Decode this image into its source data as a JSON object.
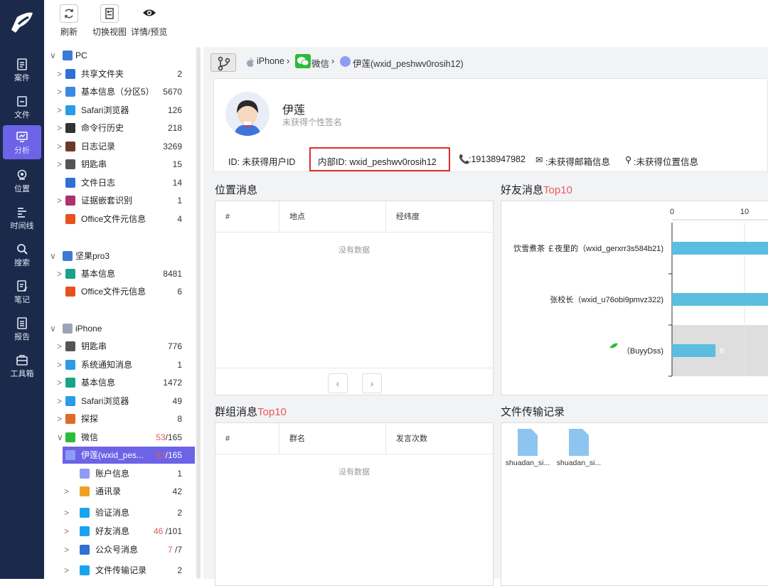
{
  "nav": [
    {
      "label": "案件",
      "icon": "clipboard-icon"
    },
    {
      "label": "文件",
      "icon": "file-icon"
    },
    {
      "label": "分析",
      "icon": "analysis-icon",
      "active": true
    },
    {
      "label": "位置",
      "icon": "location-icon"
    },
    {
      "label": "时间线",
      "icon": "timeline-icon"
    },
    {
      "label": "搜索",
      "icon": "search-icon"
    },
    {
      "label": "笔记",
      "icon": "note-icon"
    },
    {
      "label": "报告",
      "icon": "report-icon"
    },
    {
      "label": "工具箱",
      "icon": "toolbox-icon"
    }
  ],
  "toolbar": {
    "refresh": "刷新",
    "switch_view": "切换视图",
    "detail_preview": "详情/预览"
  },
  "tree": [
    {
      "label": "PC",
      "count": "",
      "level": 0,
      "arrow": "∨"
    },
    {
      "label": "共享文件夹",
      "count": "2",
      "level": 1,
      "arrow": ">"
    },
    {
      "label": "基本信息（分区5）",
      "count": "5670",
      "level": 1,
      "arrow": ">"
    },
    {
      "label": "Safari浏览器",
      "count": "126",
      "level": 1,
      "arrow": ">"
    },
    {
      "label": "命令行历史",
      "count": "218",
      "level": 1,
      "arrow": ">"
    },
    {
      "label": "日志记录",
      "count": "3269",
      "level": 1,
      "arrow": ">"
    },
    {
      "label": "钥匙串",
      "count": "15",
      "level": 1,
      "arrow": ">"
    },
    {
      "label": "文件日志",
      "count": "14",
      "level": 1,
      "arrow": ""
    },
    {
      "label": "证据嵌套识别",
      "count": "1",
      "level": 1,
      "arrow": ">"
    },
    {
      "label": "Office文件元信息",
      "count": "4",
      "level": 1,
      "arrow": ""
    },
    {
      "label": "坚果pro3",
      "count": "",
      "level": 0,
      "arrow": "∨"
    },
    {
      "label": "基本信息",
      "count": "8481",
      "level": 1,
      "arrow": ">"
    },
    {
      "label": "Office文件元信息",
      "count": "6",
      "level": 1,
      "arrow": ""
    },
    {
      "label": "iPhone",
      "count": "",
      "level": 0,
      "arrow": "∨"
    },
    {
      "label": "钥匙串",
      "count": "776",
      "level": 1,
      "arrow": ">"
    },
    {
      "label": "系统通知消息",
      "count": "1",
      "level": 1,
      "arrow": ">"
    },
    {
      "label": "基本信息",
      "count": "1472",
      "level": 1,
      "arrow": ">"
    },
    {
      "label": "Safari浏览器",
      "count": "49",
      "level": 1,
      "arrow": ">"
    },
    {
      "label": "探探",
      "count": "8",
      "level": 1,
      "arrow": ">"
    },
    {
      "label": "微信",
      "count_red": "53",
      "count": "/165",
      "level": 1,
      "arrow": "∨"
    },
    {
      "label": "伊莲(wxid_pes...",
      "count_red": "53",
      "count": "/165",
      "level": 2,
      "arrow": "∨",
      "selected": true
    },
    {
      "label": "账户信息",
      "count": "1",
      "level": 3,
      "arrow": ""
    },
    {
      "label": "通讯录",
      "count": "42",
      "level": 3,
      "arrow": ">"
    },
    {
      "label": "验证消息",
      "count": "2",
      "level": 3,
      "arrow": ">"
    },
    {
      "label": "好友消息",
      "count_red": "46",
      "count": " /101",
      "level": 3,
      "arrow": ">"
    },
    {
      "label": "公众号消息",
      "count_red": "7",
      "count": " /7",
      "level": 3,
      "arrow": ">"
    },
    {
      "label": "文件传输记录",
      "count": "2",
      "level": 3,
      "arrow": ">"
    }
  ],
  "breadcrumb": {
    "device": "iPhone",
    "app": "微信",
    "user": "伊莲(wxid_peshwv0rosih12)"
  },
  "profile": {
    "name": "伊莲",
    "signature": "未获得个性签名",
    "id": "ID: 未获得用户ID",
    "internal_id": "内部ID: wxid_peshwv0rosih12",
    "phone": ":19138947982",
    "email": ":未获得邮箱信息",
    "location": ":未获得位置信息"
  },
  "location_panel": {
    "title": "位置消息",
    "col1": "#",
    "col2": "地点",
    "col3": "经纬度",
    "empty": "没有数据"
  },
  "friend_panel": {
    "title": "好友消息",
    "title_suffix": "Top10"
  },
  "group_panel": {
    "title": "群组消息",
    "title_suffix": "Top10",
    "col1": "#",
    "col2": "群名",
    "col3": "发言次数",
    "empty": "没有数据"
  },
  "file_panel": {
    "title": "文件传输记录",
    "files": [
      "shuadan_si...",
      "shuadan_si..."
    ]
  },
  "chart_data": {
    "type": "bar",
    "orientation": "horizontal",
    "categories": [
      "饮雪煮茶 ￡夜里的（wxid_gerxrr3s584b21)",
      "张校长（wxid_u76obi9pmvz322)",
      "（BuyyDss)"
    ],
    "values": [
      null,
      null,
      6
    ],
    "xtick_labels": [
      "0",
      "10"
    ],
    "data_labels": [
      "",
      "",
      "6"
    ],
    "bar_color": "#5bbde0"
  }
}
